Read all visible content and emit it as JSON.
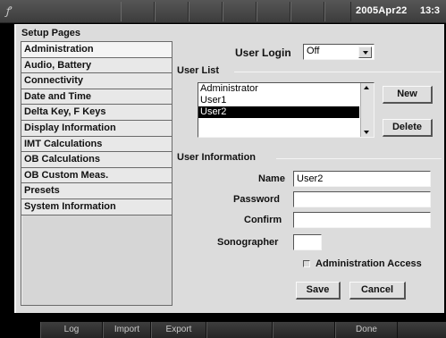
{
  "status_bar": {
    "date": "2005Apr22",
    "time": "13:3",
    "logo_icon": "sonosite-swoosh-icon"
  },
  "setup": {
    "title": "Setup Pages",
    "pages": [
      "Administration",
      "Audio, Battery",
      "Connectivity",
      "Date and Time",
      "Delta Key, F Keys",
      "Display Information",
      "IMT Calculations",
      "OB Calculations",
      "OB Custom Meas.",
      "Presets",
      "System Information"
    ],
    "active_page": "Administration"
  },
  "user_login": {
    "label": "User Login",
    "value": "Off"
  },
  "user_list": {
    "label": "User List",
    "users": [
      "Administrator",
      "User1",
      "User2"
    ],
    "selected": "User2",
    "new_label": "New",
    "delete_label": "Delete"
  },
  "user_info": {
    "label": "User Information",
    "name_label": "Name",
    "name_value": "User2",
    "password_label": "Password",
    "password_value": "",
    "confirm_label": "Confirm",
    "confirm_value": "",
    "sonographer_label": "Sonographer",
    "sonographer_value": "",
    "admin_access_label": "Administration Access",
    "admin_access_checked": false,
    "save_label": "Save",
    "cancel_label": "Cancel"
  },
  "softkeys": [
    "Log",
    "Import",
    "Export",
    "",
    "",
    "Done"
  ]
}
